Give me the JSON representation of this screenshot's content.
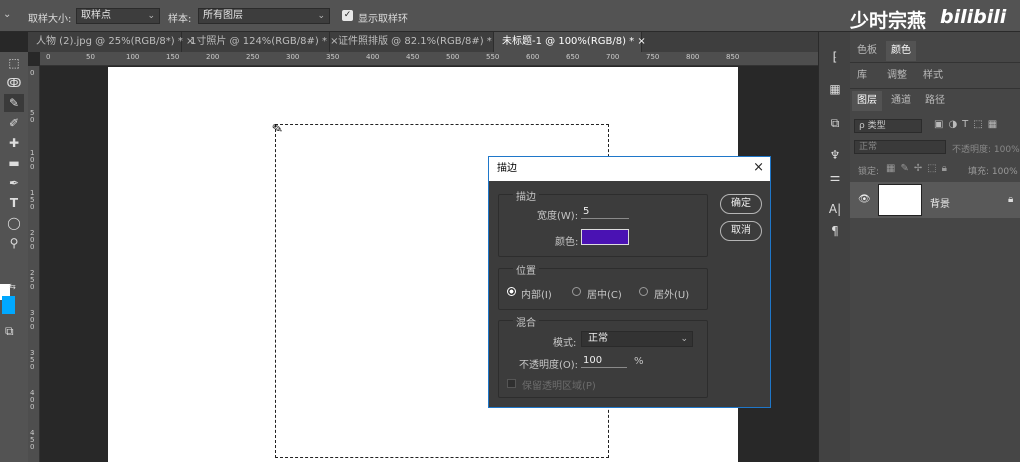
{
  "options_bar": {
    "tool_dropdown_arrow": "⌄",
    "sample_size_label": "取样大小:",
    "sample_size_value": "取样点",
    "sample_label": "样本:",
    "sample_value": "所有图层",
    "show_ring_label": "显示取样环",
    "show_ring_checked": true
  },
  "watermark": {
    "text": "少时宗燕",
    "brand": "bilibili"
  },
  "tabs": [
    {
      "label": "人物 (2).jpg @ 25%(RGB/8*) *",
      "close": "×"
    },
    {
      "label": "1寸照片 @ 124%(RGB/8#) *",
      "close": "×"
    },
    {
      "label": "证件照排版 @ 82.1%(RGB/8#) *",
      "close": "×"
    },
    {
      "label": "未标题-1 @ 100%(RGB/8) *",
      "close": "×"
    }
  ],
  "ruler_top": [
    "0",
    "50",
    "100",
    "150",
    "200",
    "250",
    "300",
    "350",
    "400",
    "450",
    "500",
    "550",
    "600",
    "650",
    "700",
    "750",
    "800",
    "850"
  ],
  "ruler_left": [
    "0",
    "5 0",
    "1 0 0",
    "1 5 0",
    "2 0 0",
    "2 5 0",
    "3 0 0",
    "3 5 0",
    "4 0 0",
    "4 5 0"
  ],
  "tools": [
    {
      "name": "marquee-tool-icon",
      "glyph": "⬚"
    },
    {
      "name": "lasso-tool-icon",
      "glyph": "ↂ"
    },
    {
      "name": "eyedropper-tool-icon",
      "glyph": "✎"
    },
    {
      "name": "brush-tool-icon",
      "glyph": "✐"
    },
    {
      "name": "healing-tool-icon",
      "glyph": "✚"
    },
    {
      "name": "eraser-tool-icon",
      "glyph": "▬"
    },
    {
      "name": "pen-tool-icon",
      "glyph": "✒"
    },
    {
      "name": "text-tool-icon",
      "glyph": "T"
    },
    {
      "name": "ellipse-tool-icon",
      "glyph": "◯"
    },
    {
      "name": "zoom-tool-icon",
      "glyph": "⚲"
    }
  ],
  "colors": {
    "foreground": "#ffffff",
    "background": "#00a8ff",
    "stroke_color": "#4a12b3",
    "accent": "#1f77c9"
  },
  "right_panel": {
    "tabs_row1": [
      "色板",
      "颜色"
    ],
    "tabs_row2": [
      "库",
      "调整",
      "样式"
    ],
    "tabs_row3": [
      "图层",
      "通道",
      "路径"
    ],
    "kind_filter": "ρ 类型",
    "blend_mode": "正常",
    "opacity_label": "不透明度: 100%",
    "lock_label": "锁定:",
    "fill_label": "填充: 100%",
    "layer_name": "背景"
  },
  "dialog": {
    "title": "描边",
    "close": "×",
    "stroke_group": "描边",
    "width_label": "宽度(W):",
    "width_value": "5",
    "color_label": "颜色:",
    "ok": "确定",
    "cancel": "取消",
    "location_group": "位置",
    "inside": "内部(I)",
    "center": "居中(C)",
    "outside": "居外(U)",
    "location_selected": "inside",
    "blend_group": "混合",
    "mode_label": "模式:",
    "mode_value": "正常",
    "opacity_label": "不透明度(O):",
    "opacity_value": "100",
    "opacity_unit": "%",
    "preserve_label": "保留透明区域(P)"
  }
}
